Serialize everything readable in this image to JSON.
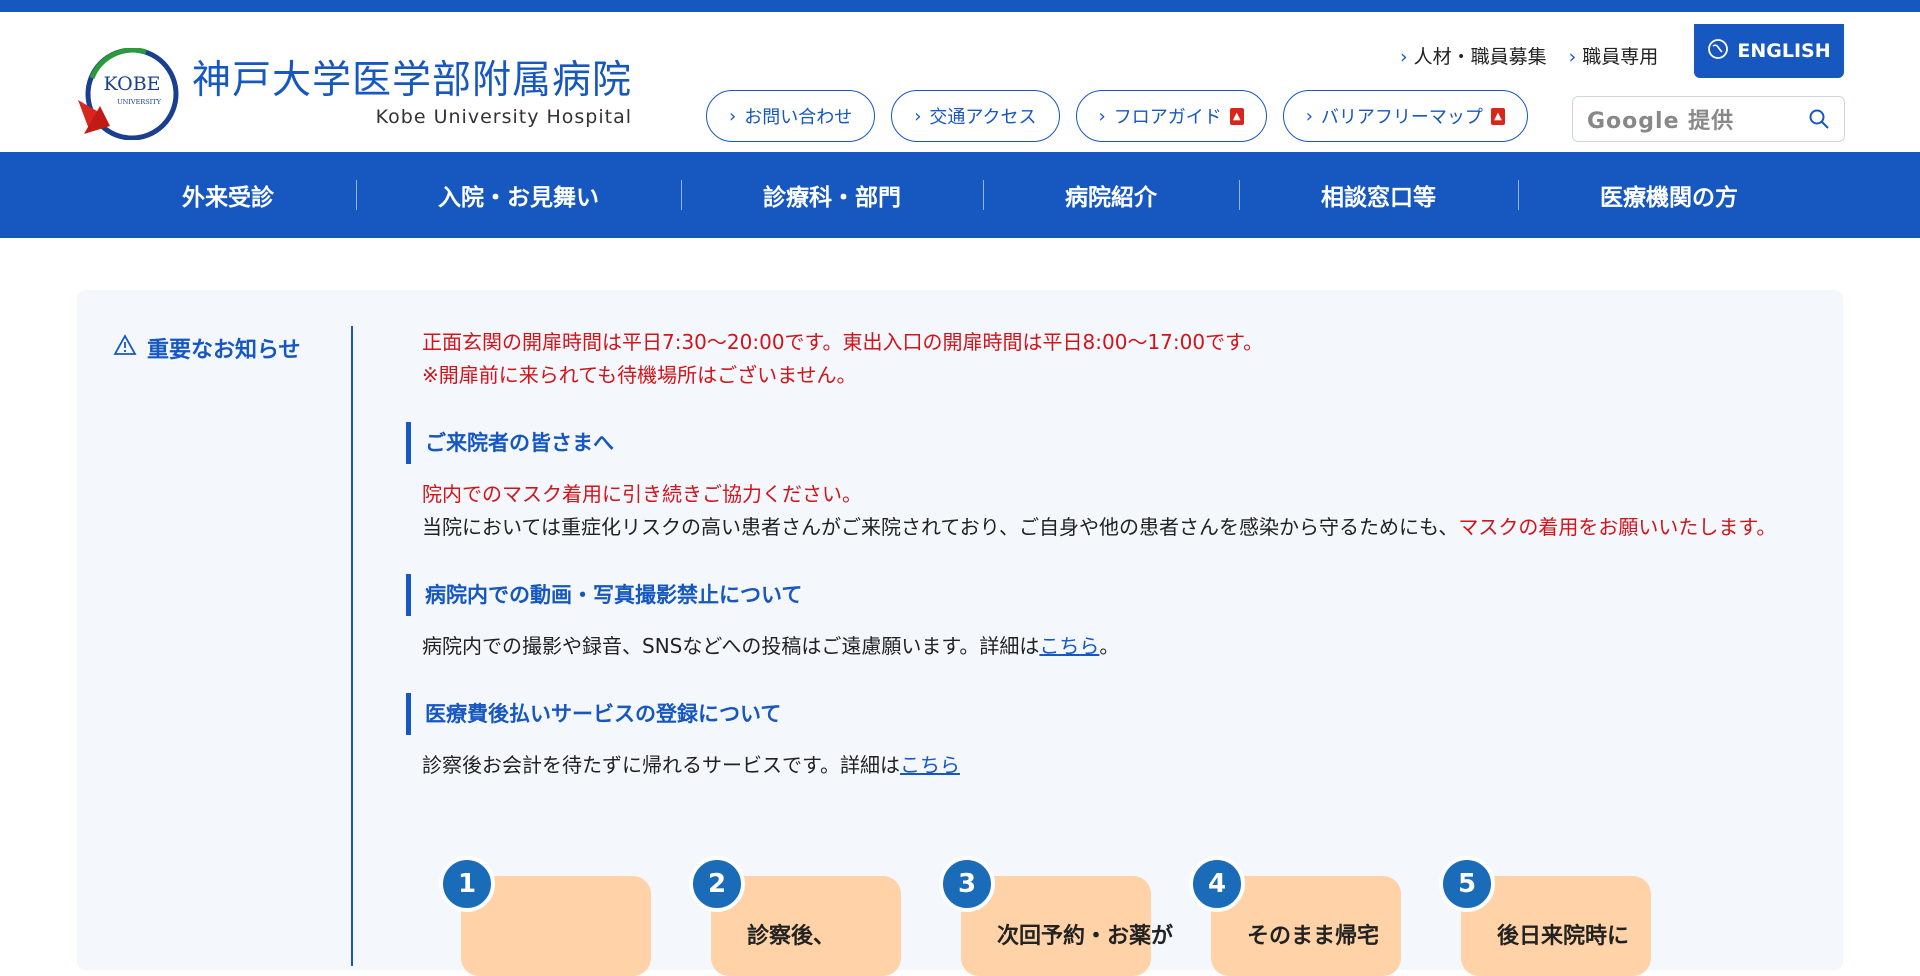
{
  "site": {
    "name_jp": "神戸大学医学部附属病院",
    "name_en": "Kobe University Hospital",
    "logo_text_top": "KOBE",
    "logo_text_sub": "UNIVERSITY"
  },
  "utility": {
    "recruit": "人材・職員募集",
    "staff": "職員専用",
    "english": "ENGLISH"
  },
  "pills": [
    {
      "label": "お問い合わせ"
    },
    {
      "label": "交通アクセス"
    },
    {
      "label": "フロアガイド"
    },
    {
      "label": "バリアフリーマップ"
    }
  ],
  "search": {
    "placeholder": "Google 提供"
  },
  "nav": [
    {
      "label": "外来受診"
    },
    {
      "label": "入院・お見舞い"
    },
    {
      "label": "診療科・部門"
    },
    {
      "label": "病院紹介"
    },
    {
      "label": "相談窓口等"
    },
    {
      "label": "医療機関の方"
    }
  ],
  "notice": {
    "label": "重要なお知らせ",
    "intro_line1": "正面玄関の開扉時間は平日7:30〜20:00です。東出入口の開扉時間は平日8:00〜17:00です。",
    "intro_line2": "※開扉前に来られても待機場所はございません。",
    "sections": [
      {
        "title": "ご来院者の皆さまへ",
        "red_line": "院内でのマスク着用に引き続きご協力ください。",
        "text_prefix": "当院においては重症化リスクの高い患者さんがご来院されており、ご自身や他の患者さんを感染から守るためにも、",
        "text_red": "マスクの着用をお願いいたします。"
      },
      {
        "title": "病院内での動画・写真撮影禁止について",
        "text_prefix": "病院内での撮影や録音、SNSなどへの投稿はご遠慮願います。詳細は",
        "link": "こちら",
        "text_suffix": "。"
      },
      {
        "title": "医療費後払いサービスの登録について",
        "text_prefix": "診察後お会計を待たずに帰れるサービスです。詳細は",
        "link": "こちら"
      }
    ],
    "steps": [
      {
        "num": "1",
        "text": ""
      },
      {
        "num": "2",
        "text": "診察後、"
      },
      {
        "num": "3",
        "text": "次回予約・お薬が"
      },
      {
        "num": "4",
        "text": "そのまま帰宅"
      },
      {
        "num": "5",
        "text": "後日来院時に"
      }
    ]
  },
  "colors": {
    "brand": "#1657c0",
    "alert": "#d1141a",
    "step_card": "#ffd2a8",
    "step_badge": "#1a6cb8"
  }
}
